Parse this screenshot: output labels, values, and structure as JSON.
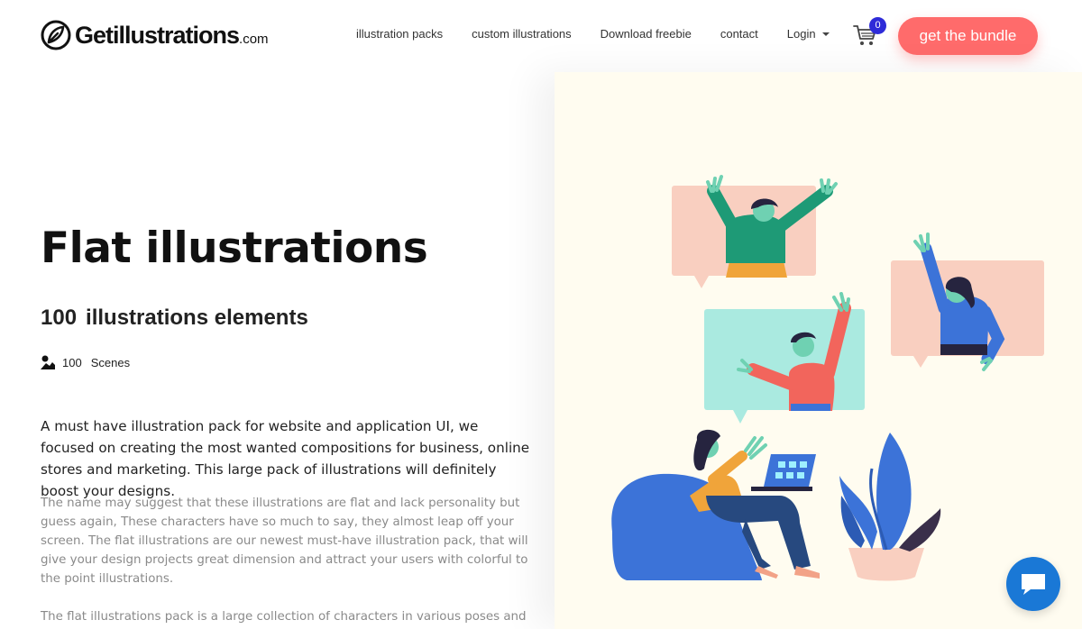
{
  "brand": {
    "name": "Getillustrations",
    "suffix": ".com"
  },
  "nav": {
    "items": [
      {
        "label": "illustration packs"
      },
      {
        "label": "custom illustrations"
      },
      {
        "label": "Download freebie"
      },
      {
        "label": "contact"
      },
      {
        "label": "Login"
      }
    ],
    "cart_count": "0",
    "cta_label": "get the bundle"
  },
  "hero": {
    "title": "Flat illustrations",
    "subtitle_count": "100",
    "subtitle_text": "illustrations elements",
    "scenes_count": "100",
    "scenes_label": "Scenes",
    "lead": "A must have illustration pack for website and application UI, we focused on creating the most wanted compositions for business, online stores and marketing. This large pack of illustrations will definitely boost your designs.",
    "paragraph1": "The name may suggest that these illustrations are flat and lack personality but guess again, These characters have so much to say, they almost leap off your screen. The flat illustrations are our newest must-have illustration pack, that will give your design projects great dimension and attract your users with colorful to the point illustrations.",
    "paragraph2": "The flat illustrations pack is a large collection of characters in various poses and"
  },
  "colors": {
    "accent": "#ff6b6b",
    "badge": "#2e2bd8",
    "panel_bg": "#fffcf0",
    "chat": "#1a78d6"
  },
  "icons": [
    "logo-mark-icon",
    "caret-down-icon",
    "cart-icon",
    "scenes-image-icon",
    "chat-icon"
  ]
}
